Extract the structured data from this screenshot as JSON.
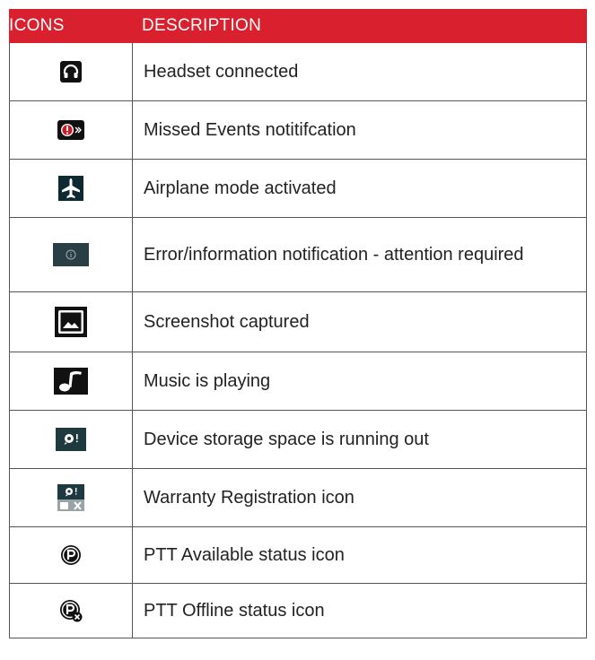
{
  "header": {
    "icons": "ICONS",
    "description": "DESCRIPTION"
  },
  "rows": [
    {
      "icon": "headset-icon",
      "description": "Headset connected"
    },
    {
      "icon": "missed-events-icon",
      "description": "Missed Events notitifcation"
    },
    {
      "icon": "airplane-icon",
      "description": "Airplane mode activated"
    },
    {
      "icon": "info-icon",
      "description": "Error/information notification -  attention required"
    },
    {
      "icon": "screenshot-icon",
      "description": "Screenshot captured"
    },
    {
      "icon": "music-icon",
      "description": "Music is playing"
    },
    {
      "icon": "storage-warning-icon",
      "description": "Device storage space is running out"
    },
    {
      "icon": "warranty-registration-icon",
      "description": "Warranty Registration icon"
    },
    {
      "icon": "ptt-available-icon",
      "description": "PTT Available status icon"
    },
    {
      "icon": "ptt-offline-icon",
      "description": "PTT Offline status icon"
    }
  ],
  "colors": {
    "header_bg": "#d8202f",
    "header_text": "#ffffff",
    "border": "#555555"
  }
}
